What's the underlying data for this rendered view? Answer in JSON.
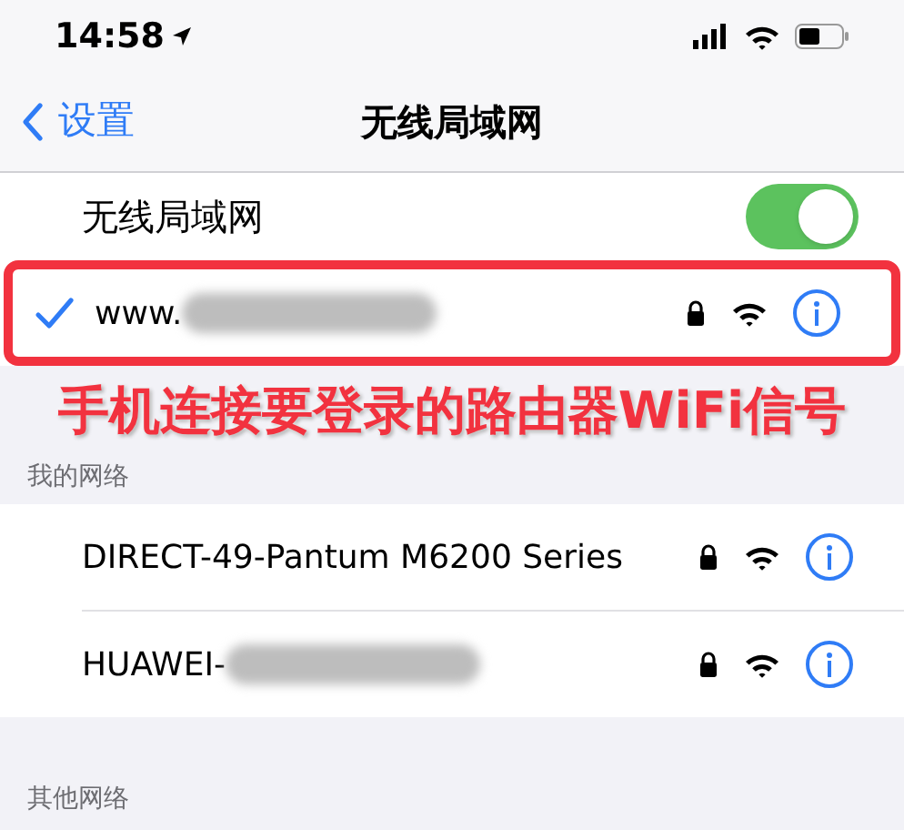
{
  "status_bar": {
    "time": "14:58"
  },
  "nav": {
    "back": "设置",
    "title": "无线局域网"
  },
  "wifi_toggle": {
    "label": "无线局域网",
    "on": true
  },
  "connected": {
    "name": "www.",
    "redacted": true,
    "locked": true,
    "selected": true,
    "highlighted": true
  },
  "annotation": "手机连接要登录的路由器WiFi信号",
  "my_networks": {
    "header": "我的网络",
    "items": [
      {
        "name": "DIRECT-49-Pantum M6200 Series",
        "redacted": false,
        "locked": true
      },
      {
        "name": "HUAWEI-",
        "redacted": true,
        "locked": true
      }
    ]
  },
  "other_networks": {
    "header": "其他网络"
  }
}
